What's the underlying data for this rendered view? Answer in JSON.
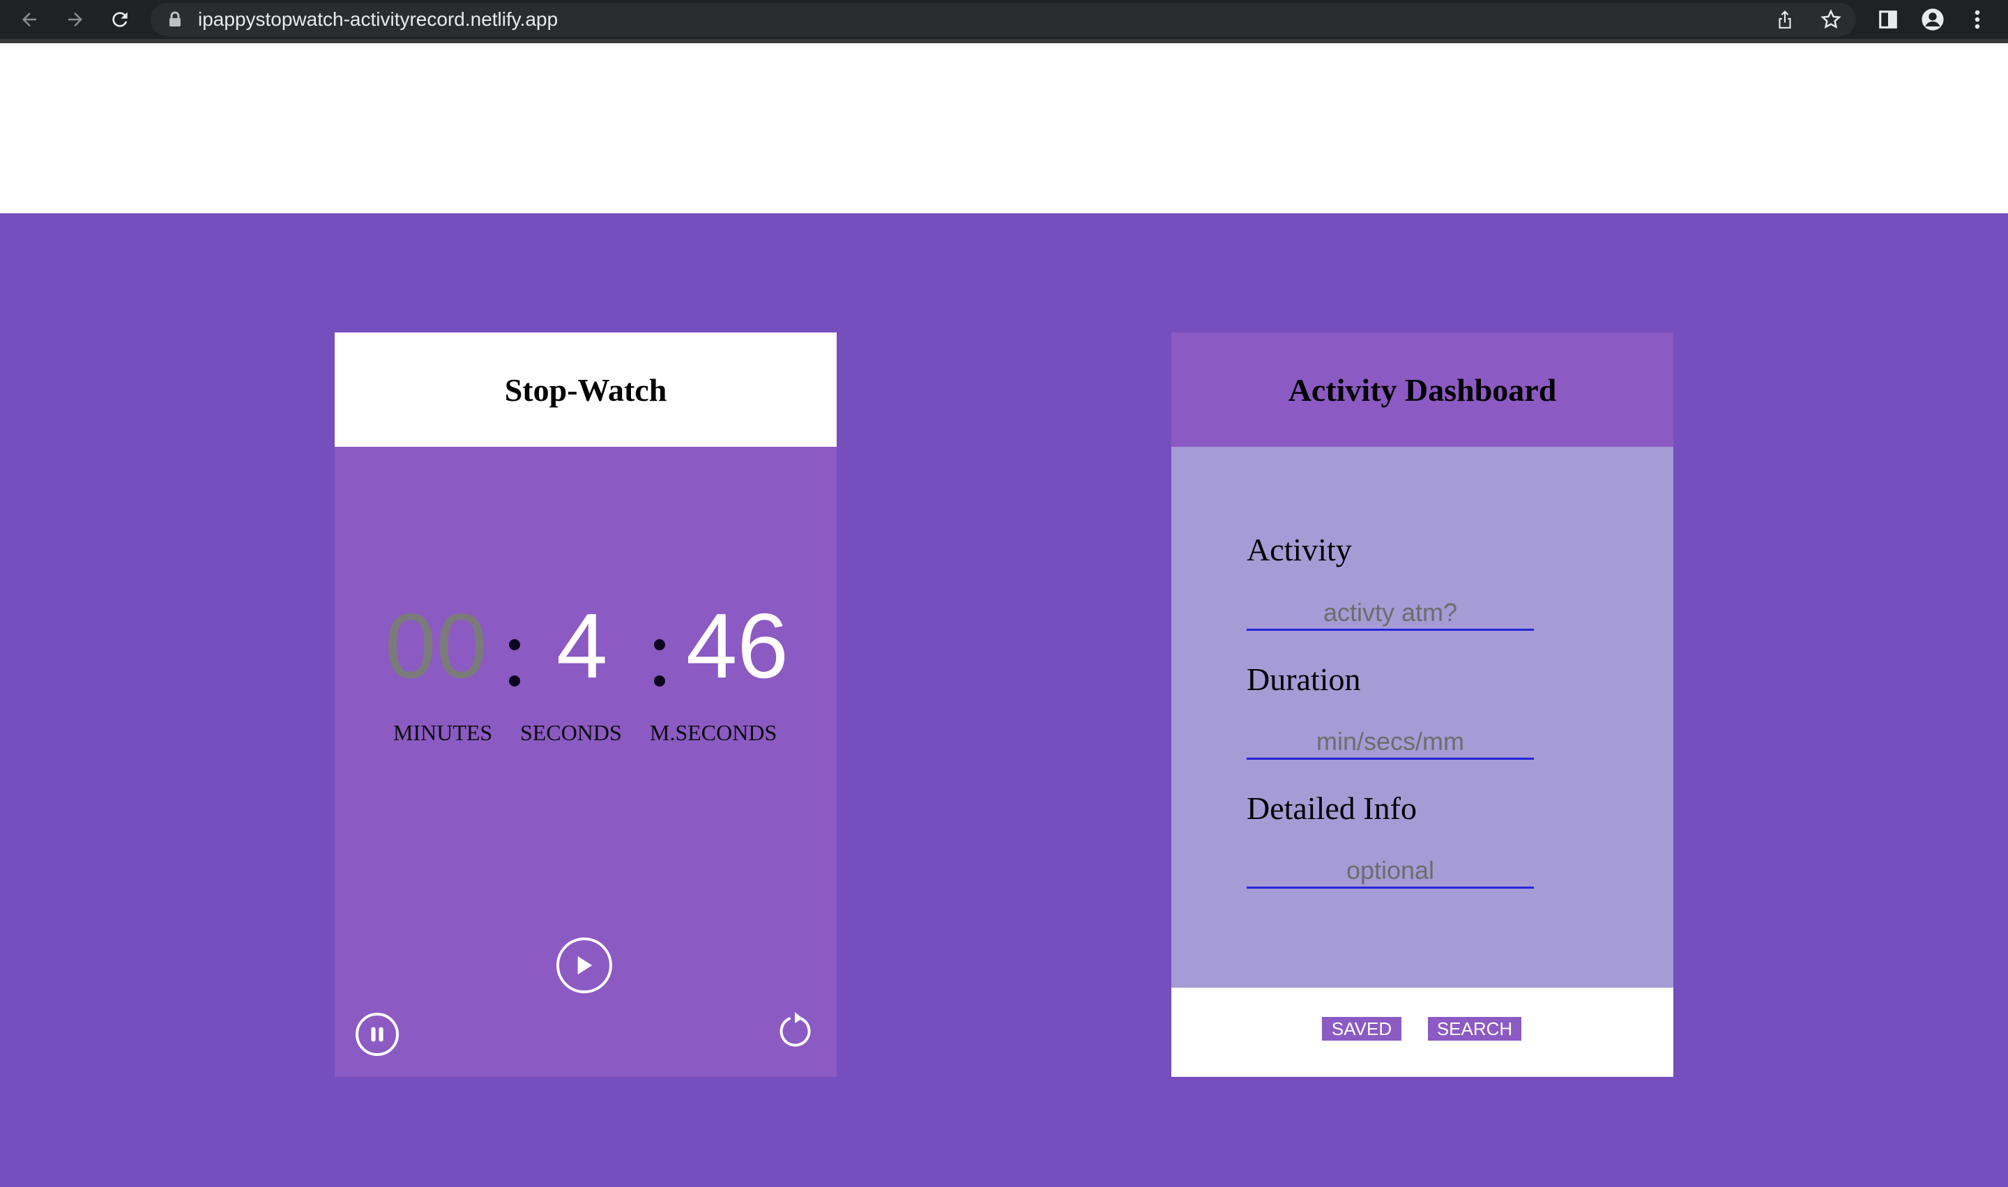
{
  "browser": {
    "url": "ipappystopwatch-activityrecord.netlify.app",
    "icons": [
      "back-arrow-icon",
      "forward-arrow-icon",
      "reload-icon",
      "lock-icon",
      "share-icon",
      "star-icon",
      "side-panel-icon",
      "profile-icon",
      "more-vert-icon"
    ]
  },
  "stopwatch": {
    "title": "Stop-Watch",
    "minutes": "00",
    "seconds": "4",
    "milliseconds": "46",
    "labels": {
      "minutes": "MINUTES",
      "seconds": "SECONDS",
      "milliseconds": "M.SECONDS"
    },
    "controls": [
      "play-icon",
      "pause-icon",
      "reset-icon"
    ]
  },
  "activity": {
    "title": "Activity Dashboard",
    "fields": [
      {
        "label": "Activity",
        "placeholder": "activty atm?",
        "value": ""
      },
      {
        "label": "Duration",
        "placeholder": "min/secs/mm",
        "value": ""
      },
      {
        "label": "Detailed Info",
        "placeholder": "optional",
        "value": ""
      }
    ],
    "buttons": {
      "saved": "SAVED",
      "search": "SEARCH"
    }
  },
  "colors": {
    "page_background": "#764fbf",
    "card_purple": "#8c5ac3",
    "form_lavender": "#a59bd5",
    "input_underline": "#2626d9",
    "minutes_gray": "#7b7b7b"
  }
}
